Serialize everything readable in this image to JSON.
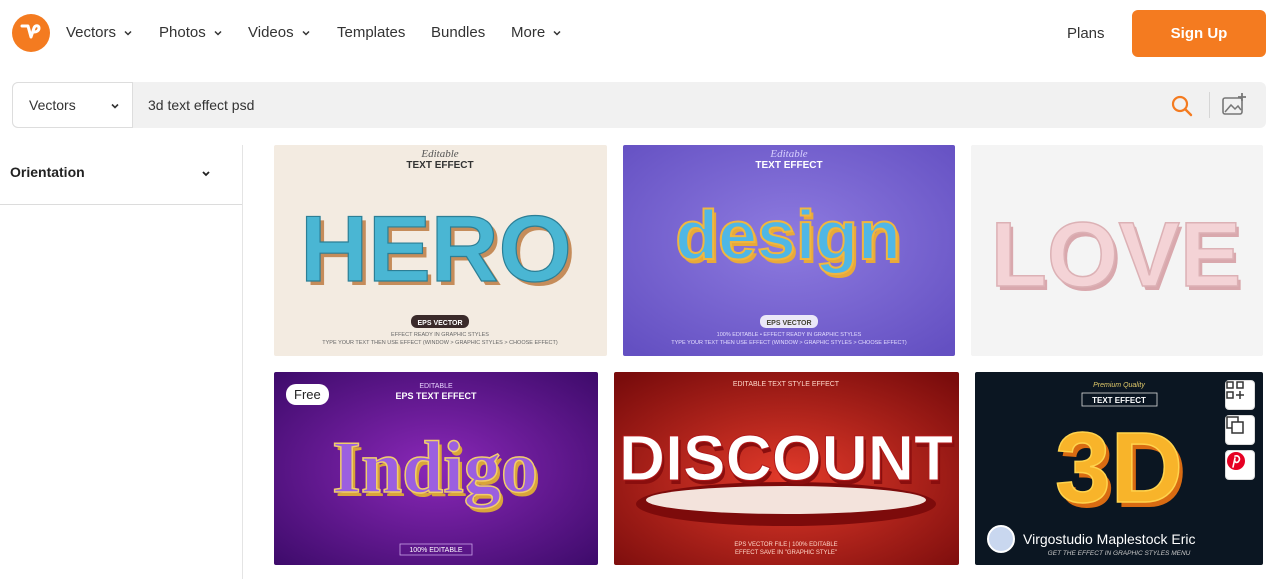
{
  "nav": {
    "items": [
      {
        "label": "Vectors",
        "dropdown": true
      },
      {
        "label": "Photos",
        "dropdown": true
      },
      {
        "label": "Videos",
        "dropdown": true
      },
      {
        "label": "Templates",
        "dropdown": false
      },
      {
        "label": "Bundles",
        "dropdown": false
      },
      {
        "label": "More",
        "dropdown": true
      }
    ],
    "plans_label": "Plans",
    "signup_label": "Sign Up"
  },
  "search": {
    "type_selected": "Vectors",
    "query": "3d text effect psd"
  },
  "sidebar": {
    "filter_label": "Orientation"
  },
  "results": [
    {
      "title": "HERO",
      "top_small": "Editable",
      "top_label": "TEXT EFFECT",
      "badge": "EPS VECTOR",
      "line1": "EFFECT READY IN GRAPHIC STYLES",
      "line2": "TYPE YOUR TEXT THEN USE EFFECT (WINDOW > GRAPHIC STYLES > CHOOSE EFFECT)"
    },
    {
      "title": "design",
      "top_small": "Editable",
      "top_label": "TEXT EFFECT",
      "badge": "EPS VECTOR",
      "line1": "100% EDITABLE • EFFECT READY IN GRAPHIC STYLES",
      "line2": "TYPE YOUR TEXT THEN USE EFFECT (WINDOW > GRAPHIC STYLES > CHOOSE EFFECT)"
    },
    {
      "title": "LOVE"
    },
    {
      "title": "Indigo",
      "free_label": "Free",
      "top_small": "EDITABLE",
      "top_label": "EPS TEXT EFFECT",
      "bottom_label": "100% EDITABLE"
    },
    {
      "title": "DISCOUNT",
      "top_label": "EDITABLE TEXT STYLE EFFECT",
      "line1": "EPS VECTOR FILE | 100% EDITABLE",
      "line2": "EFFECT SAVE IN \"GRAPHIC STYLE\""
    },
    {
      "title": "3D",
      "top_small": "Premium Quality",
      "top_label": "TEXT EFFECT",
      "author": "Virgostudio Maplestock Eric",
      "line1": "GET THE EFFECT IN GRAPHIC STYLES MENU"
    }
  ],
  "colors": {
    "accent": "#f47b20"
  }
}
